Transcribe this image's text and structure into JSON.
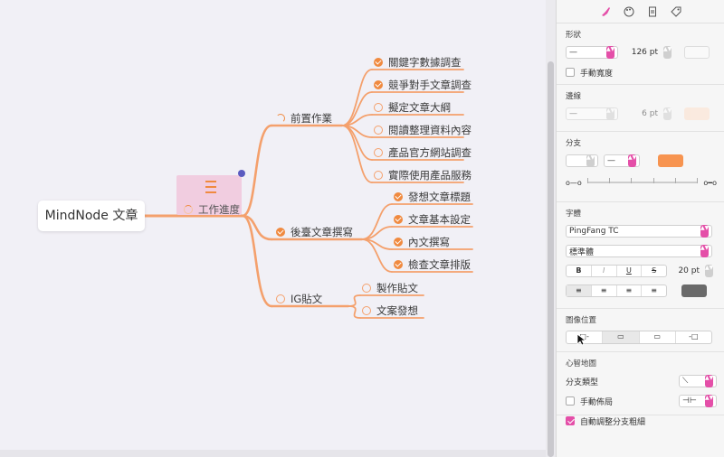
{
  "mindmap": {
    "root": "MindNode 文章",
    "main": "工作進度",
    "branches": [
      {
        "label": "前置作業",
        "status": "part",
        "items": [
          {
            "label": "關鍵字數據調查",
            "status": "done"
          },
          {
            "label": "競爭對手文章調查",
            "status": "done"
          },
          {
            "label": "擬定文章大綱",
            "status": "todo"
          },
          {
            "label": "閱讀整理資料內容",
            "status": "todo"
          },
          {
            "label": "產品官方網站調查",
            "status": "todo"
          },
          {
            "label": "實際使用產品服務",
            "status": "todo"
          }
        ]
      },
      {
        "label": "後臺文章撰寫",
        "status": "done",
        "items": [
          {
            "label": "發想文章標題",
            "status": "done"
          },
          {
            "label": "文章基本設定",
            "status": "done"
          },
          {
            "label": "內文撰寫",
            "status": "done"
          },
          {
            "label": "檢查文章排版",
            "status": "done"
          }
        ]
      },
      {
        "label": "IG貼文",
        "status": "todo",
        "items": [
          {
            "label": "製作貼文",
            "status": "todo"
          },
          {
            "label": "文案發想",
            "status": "todo"
          }
        ]
      }
    ],
    "branch_color": "#f4a06c"
  },
  "inspector": {
    "toolbar_icons": [
      "brush-icon",
      "palette-icon",
      "document-icon",
      "tag-icon"
    ],
    "shape": {
      "title": "形狀",
      "width_value": "126 pt",
      "manual_width_label": "手動寬度"
    },
    "border": {
      "title": "邊線",
      "width_value": "6 pt",
      "color": "#fde0cc"
    },
    "branch": {
      "title": "分支",
      "color": "#f79450"
    },
    "font": {
      "title": "字體",
      "family": "PingFang TC",
      "style": "標準體",
      "bold": "B",
      "italic": "I",
      "underline": "U",
      "strike": "S",
      "size": "20 pt",
      "text_color": "#6a6a6a"
    },
    "image_position": {
      "title": "圖像位置"
    },
    "mindmap": {
      "title": "心智地圖",
      "branch_type_label": "分支類型",
      "manual_layout_label": "手動佈局",
      "auto_branch_label": "自動調整分支粗細"
    },
    "accent": "#e44fa8"
  }
}
